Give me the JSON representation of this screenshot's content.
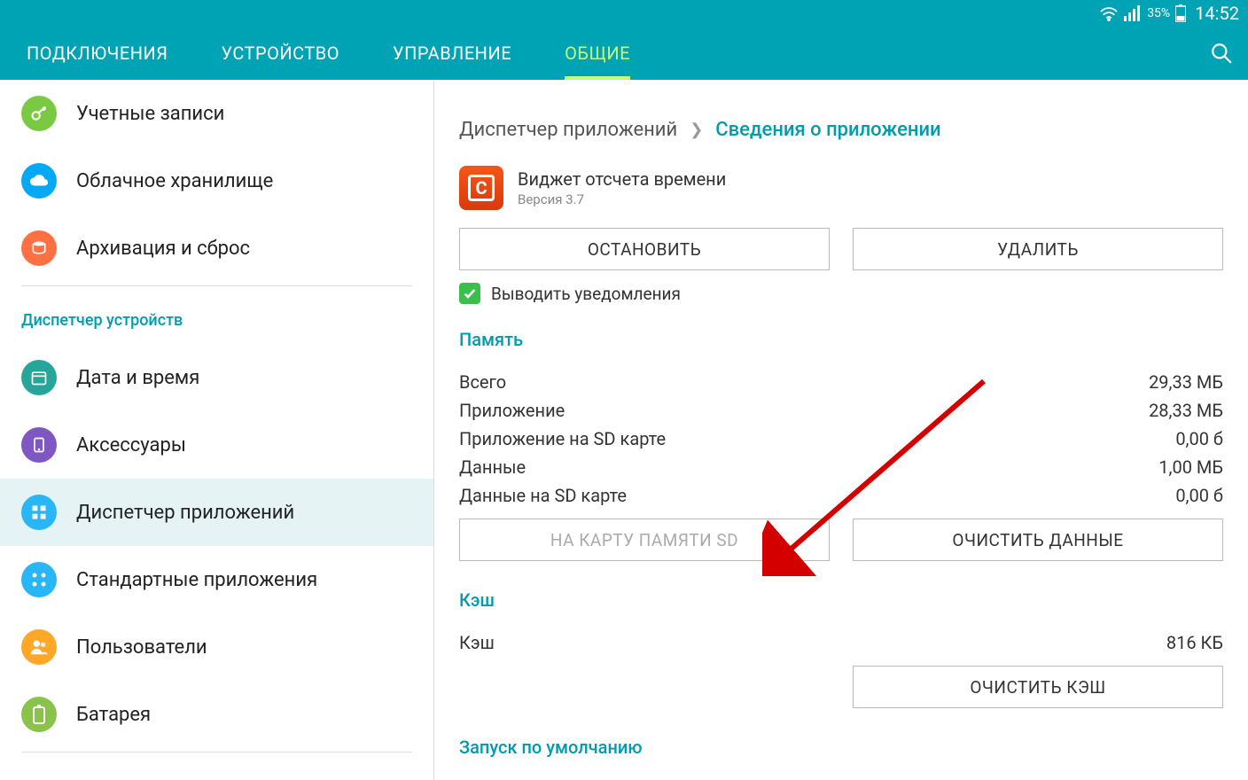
{
  "status": {
    "battery_pct": "35%",
    "time": "14:52"
  },
  "tabs": {
    "t0": "ПОДКЛЮЧЕНИЯ",
    "t1": "УСТРОЙСТВО",
    "t2": "УПРАВЛЕНИЕ",
    "t3": "ОБЩИЕ"
  },
  "sidebar": {
    "header": "Диспетчер устройств",
    "items": {
      "accounts": "Учетные записи",
      "cloud": "Облачное хранилище",
      "backup": "Архивация и сброс",
      "datetime": "Дата и время",
      "accessories": "Аксессуары",
      "appmgr": "Диспетчер приложений",
      "defaultapps": "Стандартные приложения",
      "users": "Пользователи",
      "battery": "Батарея"
    }
  },
  "breadcrumb": {
    "prev": "Диспетчер приложений",
    "curr": "Сведения о приложении"
  },
  "app": {
    "name": "Виджет отсчета времени",
    "version": "Версия 3.7"
  },
  "buttons": {
    "stop": "ОСТАНОВИТЬ",
    "delete": "УДАЛИТЬ",
    "to_sd": "НА КАРТУ ПАМЯТИ SD",
    "clear_data": "ОЧИСТИТЬ ДАННЫЕ",
    "clear_cache": "ОЧИСТИТЬ КЭШ"
  },
  "checkbox": {
    "notifications": "Выводить уведомления"
  },
  "sections": {
    "memory": "Память",
    "cache": "Кэш",
    "launch_default": "Запуск по умолчанию"
  },
  "memory": {
    "total_k": "Всего",
    "total_v": "29,33 МБ",
    "app_k": "Приложение",
    "app_v": "28,33 МБ",
    "app_sd_k": "Приложение на SD карте",
    "app_sd_v": "0,00 б",
    "data_k": "Данные",
    "data_v": "1,00 МБ",
    "data_sd_k": "Данные на SD карте",
    "data_sd_v": "0,00 б"
  },
  "cache": {
    "cache_k": "Кэш",
    "cache_v": "816 КБ"
  }
}
